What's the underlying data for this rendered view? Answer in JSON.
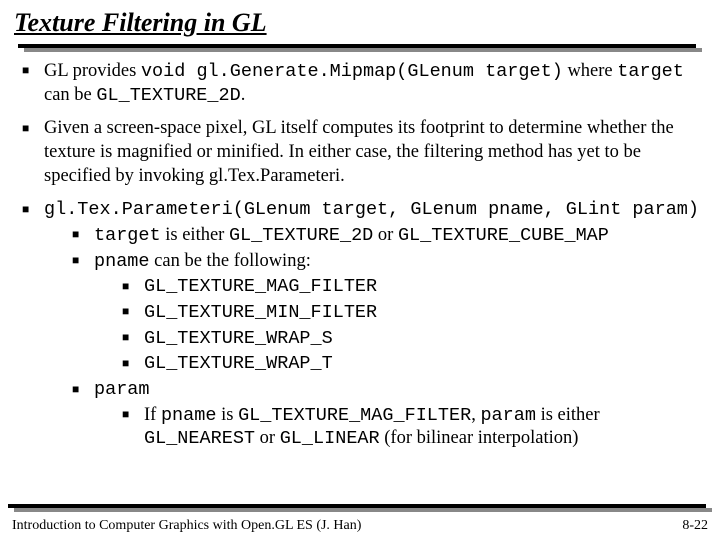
{
  "title": "Texture Filtering in GL",
  "bullets": {
    "b1_pre": "GL provides ",
    "b1_code": "void gl.Generate.Mipmap(GLenum target)",
    "b1_post1": " where ",
    "b1_code2": "target",
    "b1_post2": " can be ",
    "b1_code3": "GL_TEXTURE_2D",
    "b1_end": ".",
    "b2": "Given a screen-space pixel, GL itself computes its footprint to determine whether the texture is magnified or minified. In either case, the filtering method has yet to be specified by invoking gl.Tex.Parameteri.",
    "b3_code": "gl.Tex.Parameteri(GLenum target, GLenum pname, GLint param)",
    "b3a_code1": "target",
    "b3a_mid": " is either ",
    "b3a_code2": "GL_TEXTURE_2D",
    "b3a_mid2": " or ",
    "b3a_code3": "GL_TEXTURE_CUBE_MAP",
    "b3b_code": "pname",
    "b3b_post": " can be the following:",
    "opt1": "GL_TEXTURE_MAG_FILTER",
    "opt2": "GL_TEXTURE_MIN_FILTER",
    "opt3": "GL_TEXTURE_WRAP_S",
    "opt4": "GL_TEXTURE_WRAP_T",
    "b3c_code": "param",
    "b3c1_pre": "If ",
    "b3c1_c1": "pname",
    "b3c1_mid": " is ",
    "b3c1_c2": "GL_TEXTURE_MAG_FILTER",
    "b3c1_mid2": ", ",
    "b3c1_c3": "param",
    "b3c1_mid3": " is either ",
    "b3c1_c4": "GL_NEAREST",
    "b3c1_mid4": " or ",
    "b3c1_c5": "GL_LINEAR",
    "b3c1_post": " (for bilinear interpolation)"
  },
  "footer": {
    "left": "Introduction to Computer Graphics with Open.GL ES (J. Han)",
    "right": "8-22"
  }
}
